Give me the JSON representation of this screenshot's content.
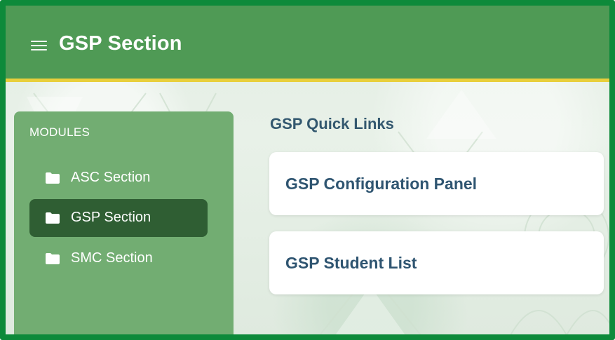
{
  "header": {
    "title": "GSP Section",
    "menu_icon": "hamburger-menu-icon",
    "background_color": "#4f9a55",
    "accent_color": "#e8cf3c"
  },
  "sidebar": {
    "heading": "MODULES",
    "items": [
      {
        "label": "ASC Section",
        "icon": "folder-icon",
        "active": false
      },
      {
        "label": "GSP Section",
        "icon": "folder-icon",
        "active": true
      },
      {
        "label": "SMC Section",
        "icon": "folder-icon",
        "active": false
      }
    ],
    "active_color": "#2f5e33"
  },
  "main": {
    "quick_links_title": "GSP Quick Links",
    "cards": [
      {
        "label": "GSP Configuration Panel"
      },
      {
        "label": "GSP Student List"
      }
    ]
  },
  "frame_color": "#0d8a3a"
}
